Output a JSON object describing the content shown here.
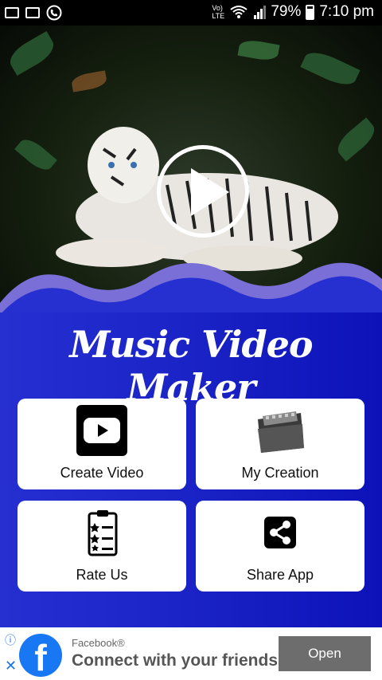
{
  "status_bar": {
    "network": "Vo) LTE",
    "battery": "79%",
    "time": "7:10 pm"
  },
  "app_title": "Music Video Maker",
  "menu": [
    {
      "label": "Create Video",
      "icon": "youtube-play-icon"
    },
    {
      "label": "My Creation",
      "icon": "film-folder-icon"
    },
    {
      "label": "Rate Us",
      "icon": "rating-clipboard-icon"
    },
    {
      "label": "Share App",
      "icon": "share-icon"
    }
  ],
  "ad": {
    "brand": "Facebook®",
    "text": "Connect with your friends",
    "button": "Open"
  },
  "colors": {
    "main_bg": "#1a23c6",
    "wave": "#7a6fd6",
    "facebook": "#1877f2"
  }
}
